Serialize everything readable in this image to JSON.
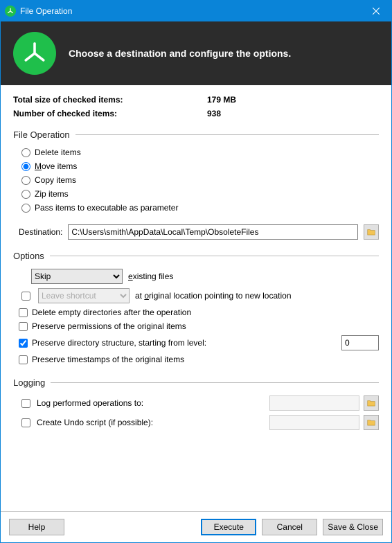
{
  "window": {
    "title": "File Operation"
  },
  "banner": {
    "text": "Choose a destination and configure the options."
  },
  "summary": {
    "size_label": "Total size of checked items:",
    "size_value": "179 MB",
    "count_label": "Number of checked items:",
    "count_value": "938"
  },
  "file_op": {
    "header": "File Operation",
    "delete": "Delete items",
    "move": "Move items",
    "copy": "Copy items",
    "zip": "Zip items",
    "pass": "Pass items to executable as parameter",
    "selected": "move",
    "dest_label": "Destination:",
    "dest_value": "C:\\Users\\smith\\AppData\\Local\\Temp\\ObsoleteFiles"
  },
  "options": {
    "header": "Options",
    "existing_select": "Skip",
    "existing_label": "existing files",
    "shortcut_select": "Leave shortcut",
    "shortcut_label": "at original location pointing to new location",
    "delete_empty": "Delete empty directories after the operation",
    "preserve_perm": "Preserve permissions of the original items",
    "preserve_struct": "Preserve directory structure, starting from level:",
    "level_value": "0",
    "preserve_time": "Preserve timestamps of the original items"
  },
  "logging": {
    "header": "Logging",
    "log_ops": "Log performed operations to:",
    "undo": "Create Undo script (if possible):"
  },
  "buttons": {
    "help": "Help",
    "execute": "Execute",
    "cancel": "Cancel",
    "save_close": "Save & Close"
  }
}
